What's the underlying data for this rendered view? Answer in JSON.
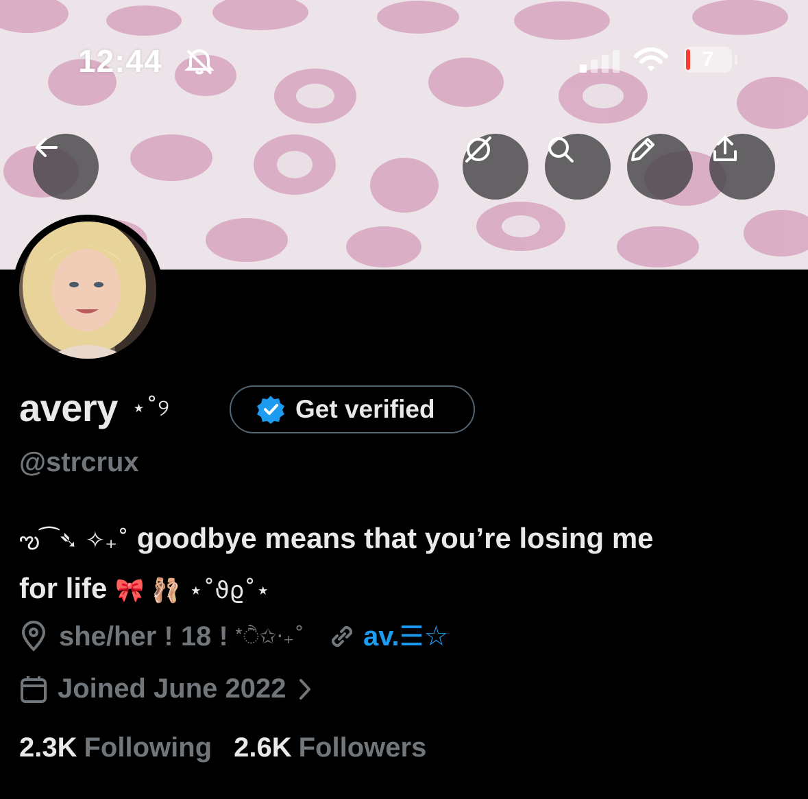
{
  "status_bar": {
    "time": "12:44",
    "battery": "7",
    "icons": [
      "bell-slash-icon",
      "signal-icon",
      "wifi-icon",
      "battery-icon"
    ]
  },
  "header_actions": {
    "back": "arrow-left-icon",
    "grok": "grok-icon",
    "search": "search-icon",
    "edit": "pencil-icon",
    "share": "share-icon"
  },
  "profile": {
    "name": "avery",
    "name_deco": "⋆˚୨",
    "verify_label": "Get verified",
    "handle": "@strcrux",
    "bio_line1_deco": "ఌ⁀➴ ✧₊˚",
    "bio_line1": "goodbye means that you’re losing me",
    "bio_line2": "for life",
    "bio_line2_emoji": "🎀 🩰",
    "bio_line2_deco": "⋆˚ϑϱ˚⋆",
    "location": "she/her ! 18 !",
    "location_deco": "*ੈ✩‧₊˚",
    "link": "av.☰☆",
    "joined": "Joined June 2022",
    "following_count": "2.3K",
    "following_label": "Following",
    "followers_count": "2.6K",
    "followers_label": "Followers"
  },
  "colors": {
    "background": "#000000",
    "banner_pink": "#d9a6c0",
    "muted": "#71767b",
    "link_blue": "#1d9bf0",
    "badge_blue": "#1d9bf0"
  }
}
